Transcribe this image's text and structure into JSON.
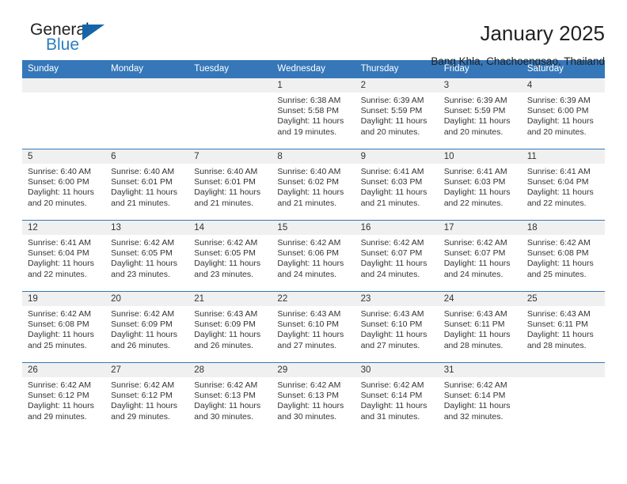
{
  "brand": {
    "name_top": "General",
    "name_bottom": "Blue",
    "triangle_icon": "triangle-icon",
    "color_primary": "#1565a8",
    "color_secondary": "#2b7cc1"
  },
  "header": {
    "title": "January 2025",
    "subtitle": "Bang Khla, Chachoengsao, Thailand"
  },
  "calendar": {
    "header_bg": "#3577b9",
    "daynum_bg": "#f0f0f0",
    "weekday_headers": [
      "Sunday",
      "Monday",
      "Tuesday",
      "Wednesday",
      "Thursday",
      "Friday",
      "Saturday"
    ],
    "weeks": [
      [
        {
          "day": "",
          "lines": []
        },
        {
          "day": "",
          "lines": []
        },
        {
          "day": "",
          "lines": []
        },
        {
          "day": "1",
          "lines": [
            "Sunrise: 6:38 AM",
            "Sunset: 5:58 PM",
            "Daylight: 11 hours and 19 minutes."
          ]
        },
        {
          "day": "2",
          "lines": [
            "Sunrise: 6:39 AM",
            "Sunset: 5:59 PM",
            "Daylight: 11 hours and 20 minutes."
          ]
        },
        {
          "day": "3",
          "lines": [
            "Sunrise: 6:39 AM",
            "Sunset: 5:59 PM",
            "Daylight: 11 hours and 20 minutes."
          ]
        },
        {
          "day": "4",
          "lines": [
            "Sunrise: 6:39 AM",
            "Sunset: 6:00 PM",
            "Daylight: 11 hours and 20 minutes."
          ]
        }
      ],
      [
        {
          "day": "5",
          "lines": [
            "Sunrise: 6:40 AM",
            "Sunset: 6:00 PM",
            "Daylight: 11 hours and 20 minutes."
          ]
        },
        {
          "day": "6",
          "lines": [
            "Sunrise: 6:40 AM",
            "Sunset: 6:01 PM",
            "Daylight: 11 hours and 21 minutes."
          ]
        },
        {
          "day": "7",
          "lines": [
            "Sunrise: 6:40 AM",
            "Sunset: 6:01 PM",
            "Daylight: 11 hours and 21 minutes."
          ]
        },
        {
          "day": "8",
          "lines": [
            "Sunrise: 6:40 AM",
            "Sunset: 6:02 PM",
            "Daylight: 11 hours and 21 minutes."
          ]
        },
        {
          "day": "9",
          "lines": [
            "Sunrise: 6:41 AM",
            "Sunset: 6:03 PM",
            "Daylight: 11 hours and 21 minutes."
          ]
        },
        {
          "day": "10",
          "lines": [
            "Sunrise: 6:41 AM",
            "Sunset: 6:03 PM",
            "Daylight: 11 hours and 22 minutes."
          ]
        },
        {
          "day": "11",
          "lines": [
            "Sunrise: 6:41 AM",
            "Sunset: 6:04 PM",
            "Daylight: 11 hours and 22 minutes."
          ]
        }
      ],
      [
        {
          "day": "12",
          "lines": [
            "Sunrise: 6:41 AM",
            "Sunset: 6:04 PM",
            "Daylight: 11 hours and 22 minutes."
          ]
        },
        {
          "day": "13",
          "lines": [
            "Sunrise: 6:42 AM",
            "Sunset: 6:05 PM",
            "Daylight: 11 hours and 23 minutes."
          ]
        },
        {
          "day": "14",
          "lines": [
            "Sunrise: 6:42 AM",
            "Sunset: 6:05 PM",
            "Daylight: 11 hours and 23 minutes."
          ]
        },
        {
          "day": "15",
          "lines": [
            "Sunrise: 6:42 AM",
            "Sunset: 6:06 PM",
            "Daylight: 11 hours and 24 minutes."
          ]
        },
        {
          "day": "16",
          "lines": [
            "Sunrise: 6:42 AM",
            "Sunset: 6:07 PM",
            "Daylight: 11 hours and 24 minutes."
          ]
        },
        {
          "day": "17",
          "lines": [
            "Sunrise: 6:42 AM",
            "Sunset: 6:07 PM",
            "Daylight: 11 hours and 24 minutes."
          ]
        },
        {
          "day": "18",
          "lines": [
            "Sunrise: 6:42 AM",
            "Sunset: 6:08 PM",
            "Daylight: 11 hours and 25 minutes."
          ]
        }
      ],
      [
        {
          "day": "19",
          "lines": [
            "Sunrise: 6:42 AM",
            "Sunset: 6:08 PM",
            "Daylight: 11 hours and 25 minutes."
          ]
        },
        {
          "day": "20",
          "lines": [
            "Sunrise: 6:42 AM",
            "Sunset: 6:09 PM",
            "Daylight: 11 hours and 26 minutes."
          ]
        },
        {
          "day": "21",
          "lines": [
            "Sunrise: 6:43 AM",
            "Sunset: 6:09 PM",
            "Daylight: 11 hours and 26 minutes."
          ]
        },
        {
          "day": "22",
          "lines": [
            "Sunrise: 6:43 AM",
            "Sunset: 6:10 PM",
            "Daylight: 11 hours and 27 minutes."
          ]
        },
        {
          "day": "23",
          "lines": [
            "Sunrise: 6:43 AM",
            "Sunset: 6:10 PM",
            "Daylight: 11 hours and 27 minutes."
          ]
        },
        {
          "day": "24",
          "lines": [
            "Sunrise: 6:43 AM",
            "Sunset: 6:11 PM",
            "Daylight: 11 hours and 28 minutes."
          ]
        },
        {
          "day": "25",
          "lines": [
            "Sunrise: 6:43 AM",
            "Sunset: 6:11 PM",
            "Daylight: 11 hours and 28 minutes."
          ]
        }
      ],
      [
        {
          "day": "26",
          "lines": [
            "Sunrise: 6:42 AM",
            "Sunset: 6:12 PM",
            "Daylight: 11 hours and 29 minutes."
          ]
        },
        {
          "day": "27",
          "lines": [
            "Sunrise: 6:42 AM",
            "Sunset: 6:12 PM",
            "Daylight: 11 hours and 29 minutes."
          ]
        },
        {
          "day": "28",
          "lines": [
            "Sunrise: 6:42 AM",
            "Sunset: 6:13 PM",
            "Daylight: 11 hours and 30 minutes."
          ]
        },
        {
          "day": "29",
          "lines": [
            "Sunrise: 6:42 AM",
            "Sunset: 6:13 PM",
            "Daylight: 11 hours and 30 minutes."
          ]
        },
        {
          "day": "30",
          "lines": [
            "Sunrise: 6:42 AM",
            "Sunset: 6:14 PM",
            "Daylight: 11 hours and 31 minutes."
          ]
        },
        {
          "day": "31",
          "lines": [
            "Sunrise: 6:42 AM",
            "Sunset: 6:14 PM",
            "Daylight: 11 hours and 32 minutes."
          ]
        },
        {
          "day": "",
          "lines": []
        }
      ]
    ]
  }
}
